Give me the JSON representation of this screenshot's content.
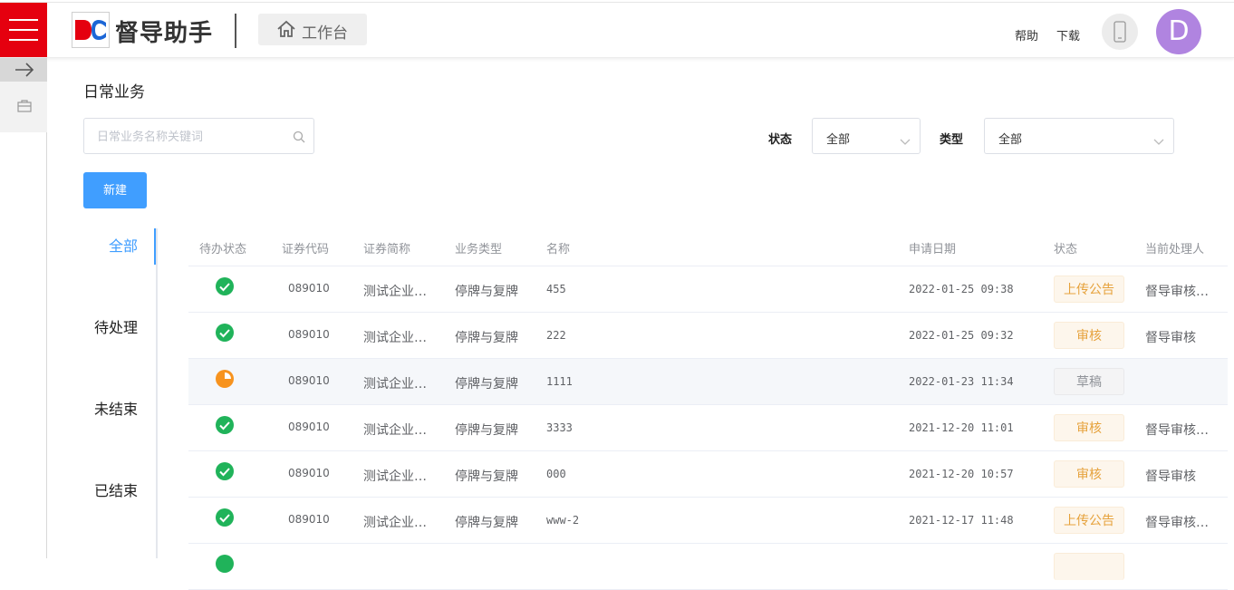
{
  "header": {
    "brand": "督导助手",
    "workbench_label": "工作台",
    "help_label": "帮助",
    "download_label": "下载",
    "avatar_letter": "D",
    "colors": {
      "menu_bg": "#e5000f",
      "avatar_bg": "#b084e0",
      "accent": "#409eff"
    }
  },
  "page": {
    "title": "日常业务",
    "search_placeholder": "日常业务名称关键词",
    "filters": {
      "status_label": "状态",
      "status_value": "全部",
      "type_label": "类型",
      "type_value": "全部"
    },
    "new_button": "新建"
  },
  "tabs": [
    {
      "label": "全部",
      "active": true
    },
    {
      "label": "待处理",
      "active": false
    },
    {
      "label": "未结束",
      "active": false
    },
    {
      "label": "已结束",
      "active": false
    }
  ],
  "table": {
    "columns": [
      "待办状态",
      "证券代码",
      "证券简称",
      "业务类型",
      "名称",
      "申请日期",
      "状态",
      "当前处理人"
    ],
    "rows": [
      {
        "todo": "done",
        "code": "089010",
        "short": "测试企业…",
        "type": "停牌与复牌",
        "name": "455",
        "date": "2022-01-25 09:38",
        "status": "上传公告",
        "status_kind": "orange",
        "handler": "督导审核…"
      },
      {
        "todo": "done",
        "code": "089010",
        "short": "测试企业…",
        "type": "停牌与复牌",
        "name": "222",
        "date": "2022-01-25 09:32",
        "status": "审核",
        "status_kind": "orange",
        "handler": "督导审核"
      },
      {
        "todo": "partial",
        "code": "089010",
        "short": "测试企业…",
        "type": "停牌与复牌",
        "name": "1111",
        "date": "2022-01-23 11:34",
        "status": "草稿",
        "status_kind": "gray",
        "handler": ""
      },
      {
        "todo": "done",
        "code": "089010",
        "short": "测试企业…",
        "type": "停牌与复牌",
        "name": "3333",
        "date": "2021-12-20 11:01",
        "status": "审核",
        "status_kind": "orange",
        "handler": "督导审核…"
      },
      {
        "todo": "done",
        "code": "089010",
        "short": "测试企业…",
        "type": "停牌与复牌",
        "name": "000",
        "date": "2021-12-20 10:57",
        "status": "审核",
        "status_kind": "orange",
        "handler": "督导审核"
      },
      {
        "todo": "done",
        "code": "089010",
        "short": "测试企业…",
        "type": "停牌与复牌",
        "name": "www-2",
        "date": "2021-12-17 11:48",
        "status": "上传公告",
        "status_kind": "orange",
        "handler": "督导审核…"
      }
    ]
  }
}
